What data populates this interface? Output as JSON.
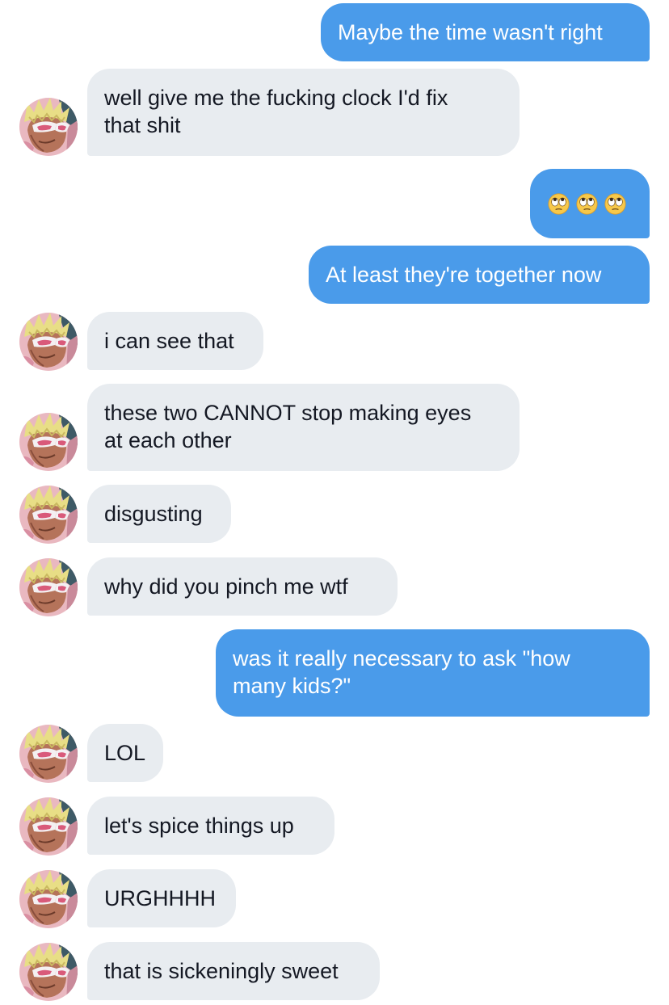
{
  "conversation": {
    "messages": [
      {
        "from": "me",
        "text": "Maybe the time wasn't right"
      },
      {
        "from": "them",
        "line1": "well give me the fucking clock I'd fix",
        "line2": "that shit"
      },
      {
        "from": "me",
        "emojis": [
          "face-with-rolling-eyes-icon",
          "face-with-rolling-eyes-icon",
          "face-with-rolling-eyes-icon"
        ]
      },
      {
        "from": "me",
        "text": "At least they're together now"
      },
      {
        "from": "them",
        "text": "i can see that"
      },
      {
        "from": "them",
        "line1": "these two CANNOT stop making eyes",
        "line2": "at each other"
      },
      {
        "from": "them",
        "text": "disgusting"
      },
      {
        "from": "them",
        "text": "why did you pinch me wtf"
      },
      {
        "from": "me",
        "line1": "was it really necessary to ask \"how",
        "line2": "many kids?\""
      },
      {
        "from": "them",
        "text": "LOL"
      },
      {
        "from": "them",
        "text": "let's spice things up"
      },
      {
        "from": "them",
        "text": "URGHHHH"
      },
      {
        "from": "them",
        "text": "that is sickeningly sweet"
      }
    ]
  },
  "colors": {
    "sent_bubble": "#4a9bea",
    "received_bubble": "#e8ecf0",
    "sent_text": "#ffffff",
    "received_text": "#141823"
  },
  "avatar_icon": "anime-character-avatar-icon"
}
